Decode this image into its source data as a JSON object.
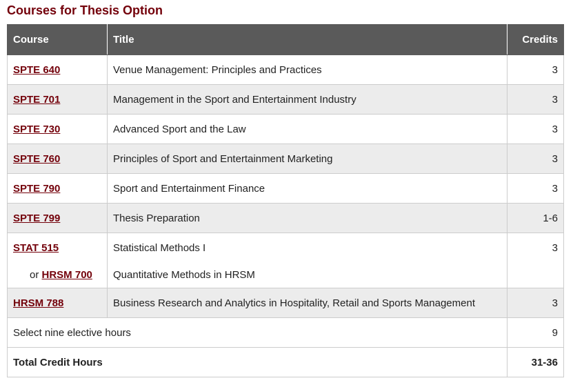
{
  "heading": "Courses for Thesis Option",
  "columns": {
    "course": "Course",
    "title": "Title",
    "credits": "Credits"
  },
  "rows": [
    {
      "code": "SPTE 640",
      "title": "Venue Management: Principles and Practices",
      "credits": "3"
    },
    {
      "code": "SPTE 701",
      "title": "Management in the Sport and Entertainment Industry",
      "credits": "3"
    },
    {
      "code": "SPTE 730",
      "title": "Advanced Sport and the Law",
      "credits": "3"
    },
    {
      "code": "SPTE 760",
      "title": "Principles of Sport and Entertainment Marketing",
      "credits": "3"
    },
    {
      "code": "SPTE 790",
      "title": "Sport and Entertainment Finance",
      "credits": "3"
    },
    {
      "code": "SPTE 799",
      "title": "Thesis Preparation",
      "credits": "1-6"
    },
    {
      "code": "STAT 515",
      "title": "Statistical Methods I",
      "credits": "3"
    },
    {
      "code": "HRSM 700",
      "or_prefix": "or",
      "title": "Quantitative Methods in HRSM",
      "credits": ""
    },
    {
      "code": "HRSM 788",
      "title": "Business Research and Analytics in Hospitality, Retail and Sports Management",
      "credits": "3"
    }
  ],
  "elective": {
    "label": "Select nine elective hours",
    "credits": "9"
  },
  "total": {
    "label": "Total Credit Hours",
    "credits": "31-36"
  },
  "colors": {
    "accent": "#73000a",
    "header_bg": "#5a5a5a",
    "alt_row": "#ececec"
  }
}
